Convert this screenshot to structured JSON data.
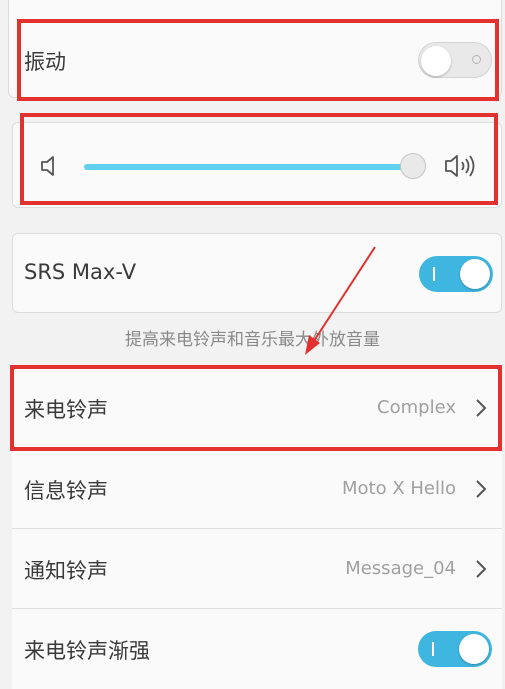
{
  "vibration": {
    "label": "振动",
    "toggle_on": false
  },
  "volume": {
    "level": 0.94
  },
  "srs": {
    "label": "SRS Max-V",
    "toggle_on": true,
    "description": "提高来电铃声和音乐最大外放音量"
  },
  "ringtones": [
    {
      "label": "来电铃声",
      "value": "Complex"
    },
    {
      "label": "信息铃声",
      "value": "Moto X Hello"
    },
    {
      "label": "通知铃声",
      "value": "Message_04"
    }
  ],
  "ring_crescendo": {
    "label": "来电铃声渐强",
    "toggle_on": true
  },
  "colors": {
    "accent": "#3fb6e0",
    "annotation": "#e2312f"
  },
  "icons": {
    "volume_low": "speaker-low-icon",
    "volume_high": "speaker-high-icon",
    "chevron": "chevron-right-icon"
  }
}
